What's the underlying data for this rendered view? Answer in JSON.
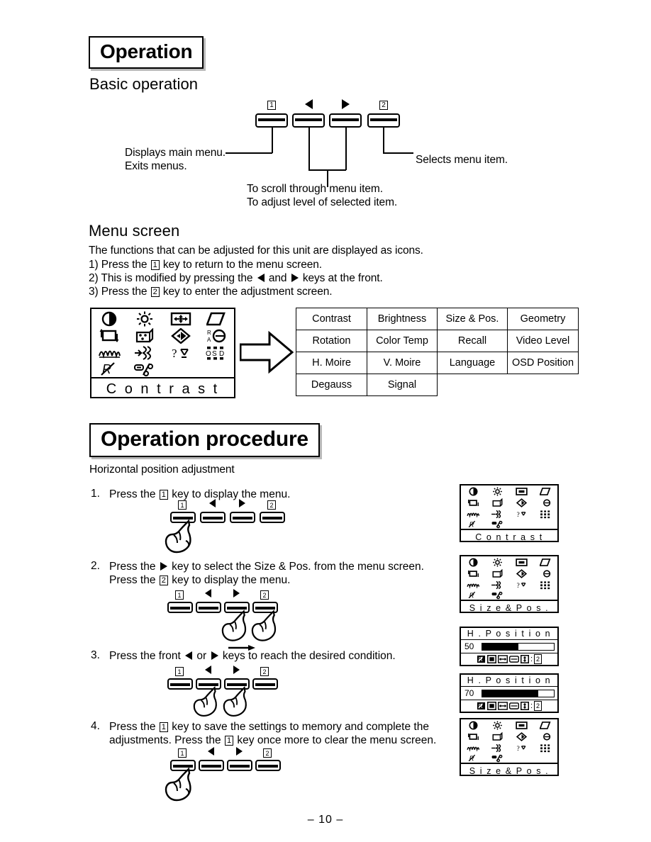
{
  "page": {
    "number": "– 10 –"
  },
  "section_operation": {
    "banner": "Operation",
    "subheading": "Basic operation",
    "buttons": [
      {
        "label": "1",
        "glyph": "box-1-icon"
      },
      {
        "label": "◁",
        "glyph": "triangle-left-icon"
      },
      {
        "label": "▷",
        "glyph": "triangle-right-icon"
      },
      {
        "label": "2",
        "glyph": "box-2-icon"
      }
    ],
    "callouts": {
      "left_line1": "Displays main menu.",
      "left_line2": "Exits menus.",
      "center_line1": "To scroll through menu item.",
      "center_line2": "To adjust level of selected item.",
      "right": "Selects menu item."
    }
  },
  "section_menu_screen": {
    "subheading": "Menu screen",
    "intro": "The functions that can be adjusted for this unit are displayed as icons.",
    "steps": [
      {
        "prefix": "1) Press the",
        "key": "1",
        "suffix": "key to return to the menu screen."
      },
      {
        "prefix": "2) This is modified by pressing the",
        "key_left": "◀",
        "mid": "and",
        "key_right": "▶",
        "suffix": "keys at the front."
      },
      {
        "prefix": "3) Press the",
        "key": "2",
        "suffix": "key to enter the adjustment screen."
      }
    ],
    "osd_panel": {
      "label": "C o n t r a s t",
      "icons": [
        "contrast-icon",
        "brightness-icon",
        "size-and-position-icon",
        "geometry-icon",
        "rotation-icon",
        "color-temp-icon",
        "recall-icon",
        "video-level-icon",
        "h-moire-icon",
        "v-moire-icon",
        "language-icon",
        "osd-position-icon",
        "degauss-icon",
        "signal-icon"
      ]
    },
    "arrow": "right-arrow-icon",
    "function_table": {
      "rows": [
        [
          "Contrast",
          "Brightness",
          "Size & Pos.",
          "Geometry"
        ],
        [
          "Rotation",
          "Color Temp",
          "Recall",
          "Video Level"
        ],
        [
          "H. Moire",
          "V. Moire",
          "Language",
          "OSD Position"
        ],
        [
          "Degauss",
          "Signal",
          "",
          ""
        ]
      ]
    }
  },
  "section_procedure": {
    "banner": "Operation procedure",
    "subheading": "Horizontal position adjustment",
    "steps": [
      {
        "number": "1.",
        "line1_a": "Press the",
        "line1_key": "1",
        "line1_b": "key to display the menu.",
        "line2_a": "",
        "line2_key": "",
        "line2_b": ""
      },
      {
        "number": "2.",
        "line1_a": "Press the",
        "line1_key": "▶",
        "line1_b": "key to select the Size & Pos. from the menu screen.",
        "line2_a": "Press the",
        "line2_key": "2",
        "line2_b": "key to display the menu."
      },
      {
        "number": "3.",
        "line1_a": "Press the front",
        "line1_key": "◀",
        "line1_mid": "or",
        "line1_key2": "▶",
        "line1_b": "keys to reach the desired condition.",
        "line2_a": "",
        "line2_key": "",
        "line2_b": ""
      },
      {
        "number": "4.",
        "line1_a": "Press the",
        "line1_key": "1",
        "line1_b": "key to save the settings to memory and complete the",
        "line2_a": "adjustments.  Press the",
        "line2_key": "1",
        "line2_b": "key once more to clear the menu screen."
      }
    ],
    "result_panels": [
      {
        "type": "menu",
        "label": "C o n t r a s t"
      },
      {
        "type": "menu",
        "label": "S i z e & P o s ."
      },
      {
        "type": "adjust",
        "title": "H . P o s i t i o n",
        "value": "50",
        "fill_percent": 50
      },
      {
        "type": "adjust",
        "title": "H . P o s i t i o n",
        "value": "70",
        "fill_percent": 78
      },
      {
        "type": "menu",
        "label": "S i z e & P o s ."
      }
    ],
    "adjust_panel_footer": {
      "icons": [
        "degauss-small-icon",
        "h-position-small-icon",
        "h-size-small-icon",
        "v-position-small-icon",
        "v-size-small-icon"
      ],
      "separator": ":",
      "key": "2"
    }
  }
}
